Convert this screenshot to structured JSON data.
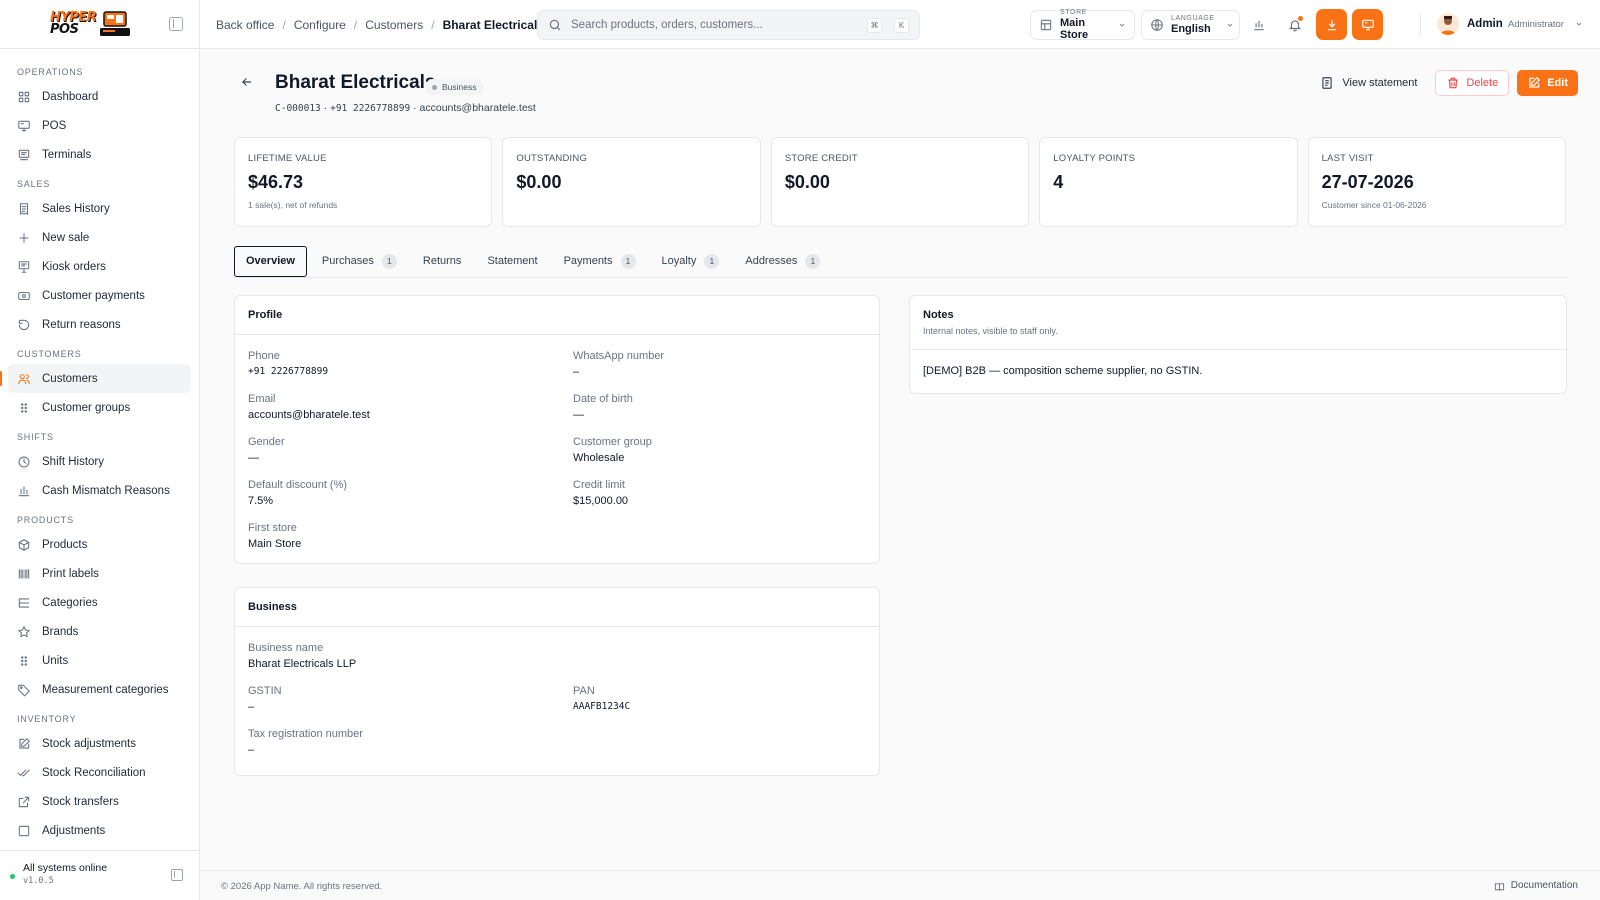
{
  "app": {
    "logo_line1": "HYPER",
    "logo_line2": "POS",
    "brand_color": "#f97316"
  },
  "sidebar": {
    "sections": [
      {
        "title": "OPERATIONS",
        "items": [
          {
            "label": "Dashboard",
            "icon": "grid-icon"
          },
          {
            "label": "POS",
            "icon": "monitor-icon"
          },
          {
            "label": "Terminals",
            "icon": "terminal-icon"
          }
        ]
      },
      {
        "title": "SALES",
        "items": [
          {
            "label": "Sales History",
            "icon": "receipt-icon"
          },
          {
            "label": "New sale",
            "icon": "plus-icon"
          },
          {
            "label": "Kiosk orders",
            "icon": "kiosk-icon"
          },
          {
            "label": "Customer payments",
            "icon": "banknote-icon"
          },
          {
            "label": "Return reasons",
            "icon": "undo-icon"
          }
        ]
      },
      {
        "title": "CUSTOMERS",
        "items": [
          {
            "label": "Customers",
            "icon": "users-icon",
            "active": true
          },
          {
            "label": "Customer groups",
            "icon": "grip-icon"
          }
        ]
      },
      {
        "title": "SHIFTS",
        "items": [
          {
            "label": "Shift History",
            "icon": "clock-icon"
          },
          {
            "label": "Cash Mismatch Reasons",
            "icon": "bar-chart-icon"
          }
        ]
      },
      {
        "title": "PRODUCTS",
        "items": [
          {
            "label": "Products",
            "icon": "package-icon"
          },
          {
            "label": "Print labels",
            "icon": "barcode-icon"
          },
          {
            "label": "Categories",
            "icon": "list-tree-icon"
          },
          {
            "label": "Brands",
            "icon": "star-icon"
          },
          {
            "label": "Units",
            "icon": "grip-icon"
          },
          {
            "label": "Measurement categories",
            "icon": "tag-icon"
          }
        ]
      },
      {
        "title": "INVENTORY",
        "items": [
          {
            "label": "Stock adjustments",
            "icon": "edit-icon"
          },
          {
            "label": "Stock Reconciliation",
            "icon": "check-check-icon"
          },
          {
            "label": "Stock transfers",
            "icon": "external-link-icon"
          },
          {
            "label": "Adjustments",
            "icon": "square-icon"
          }
        ]
      }
    ],
    "footer": {
      "status": "All systems online",
      "version": "v1.0.5"
    }
  },
  "topbar": {
    "breadcrumb": [
      "Back office",
      "Configure",
      "Customers",
      "Bharat Electricals"
    ],
    "search_placeholder": "Search products, orders, customers...",
    "kbd1": "⌘",
    "kbd2": "K",
    "store_label": "STORE",
    "store_value": "Main Store",
    "language_label": "LANGUAGE",
    "language_value": "English",
    "user_name": "Admin",
    "user_role": "Administrator"
  },
  "customer": {
    "name": "Bharat Electricals",
    "type_badge": "Business",
    "code": "C-000013",
    "phone_short": "+91 2226778899",
    "email": "accounts@bharatele.test",
    "sep": "·"
  },
  "actions": {
    "view_statement": "View statement",
    "delete": "Delete",
    "edit": "Edit"
  },
  "stats": [
    {
      "label": "LIFETIME VALUE",
      "value": "$46.73",
      "sub": "1 sale(s), net of refunds"
    },
    {
      "label": "OUTSTANDING",
      "value": "$0.00",
      "sub": ""
    },
    {
      "label": "STORE CREDIT",
      "value": "$0.00",
      "sub": ""
    },
    {
      "label": "LOYALTY POINTS",
      "value": "4",
      "sub": ""
    },
    {
      "label": "LAST VISIT",
      "value": "27-07-2026",
      "sub": "Customer since 01-06-2026"
    }
  ],
  "tabs": [
    {
      "label": "Overview",
      "count": null,
      "active": true
    },
    {
      "label": "Purchases",
      "count": "1"
    },
    {
      "label": "Returns",
      "count": null
    },
    {
      "label": "Statement",
      "count": null
    },
    {
      "label": "Payments",
      "count": "1"
    },
    {
      "label": "Loyalty",
      "count": "1"
    },
    {
      "label": "Addresses",
      "count": "1"
    }
  ],
  "profile": {
    "title": "Profile",
    "phone_label": "Phone",
    "phone_value": "+91 2226778899",
    "whatsapp_label": "WhatsApp number",
    "whatsapp_value": "–",
    "email_label": "Email",
    "email_value": "accounts@bharatele.test",
    "dob_label": "Date of birth",
    "dob_value": "—",
    "gender_label": "Gender",
    "gender_value": "—",
    "group_label": "Customer group",
    "group_value": "Wholesale",
    "discount_label": "Default discount (%)",
    "discount_value": "7.5%",
    "credit_label": "Credit limit",
    "credit_value": "$15,000.00",
    "store_label": "First store",
    "store_value": "Main Store"
  },
  "business": {
    "title": "Business",
    "name_label": "Business name",
    "name_value": "Bharat Electricals LLP",
    "gstin_label": "GSTIN",
    "gstin_value": "–",
    "pan_label": "PAN",
    "pan_value": "AAAFB1234C",
    "trn_label": "Tax registration number",
    "trn_value": "–"
  },
  "notes": {
    "title": "Notes",
    "desc": "Internal notes, visible to staff only.",
    "body": "[DEMO] B2B — composition scheme supplier, no GSTIN."
  },
  "footer": {
    "copyright": "© 2026 App Name. All rights reserved.",
    "docs": "Documentation"
  }
}
